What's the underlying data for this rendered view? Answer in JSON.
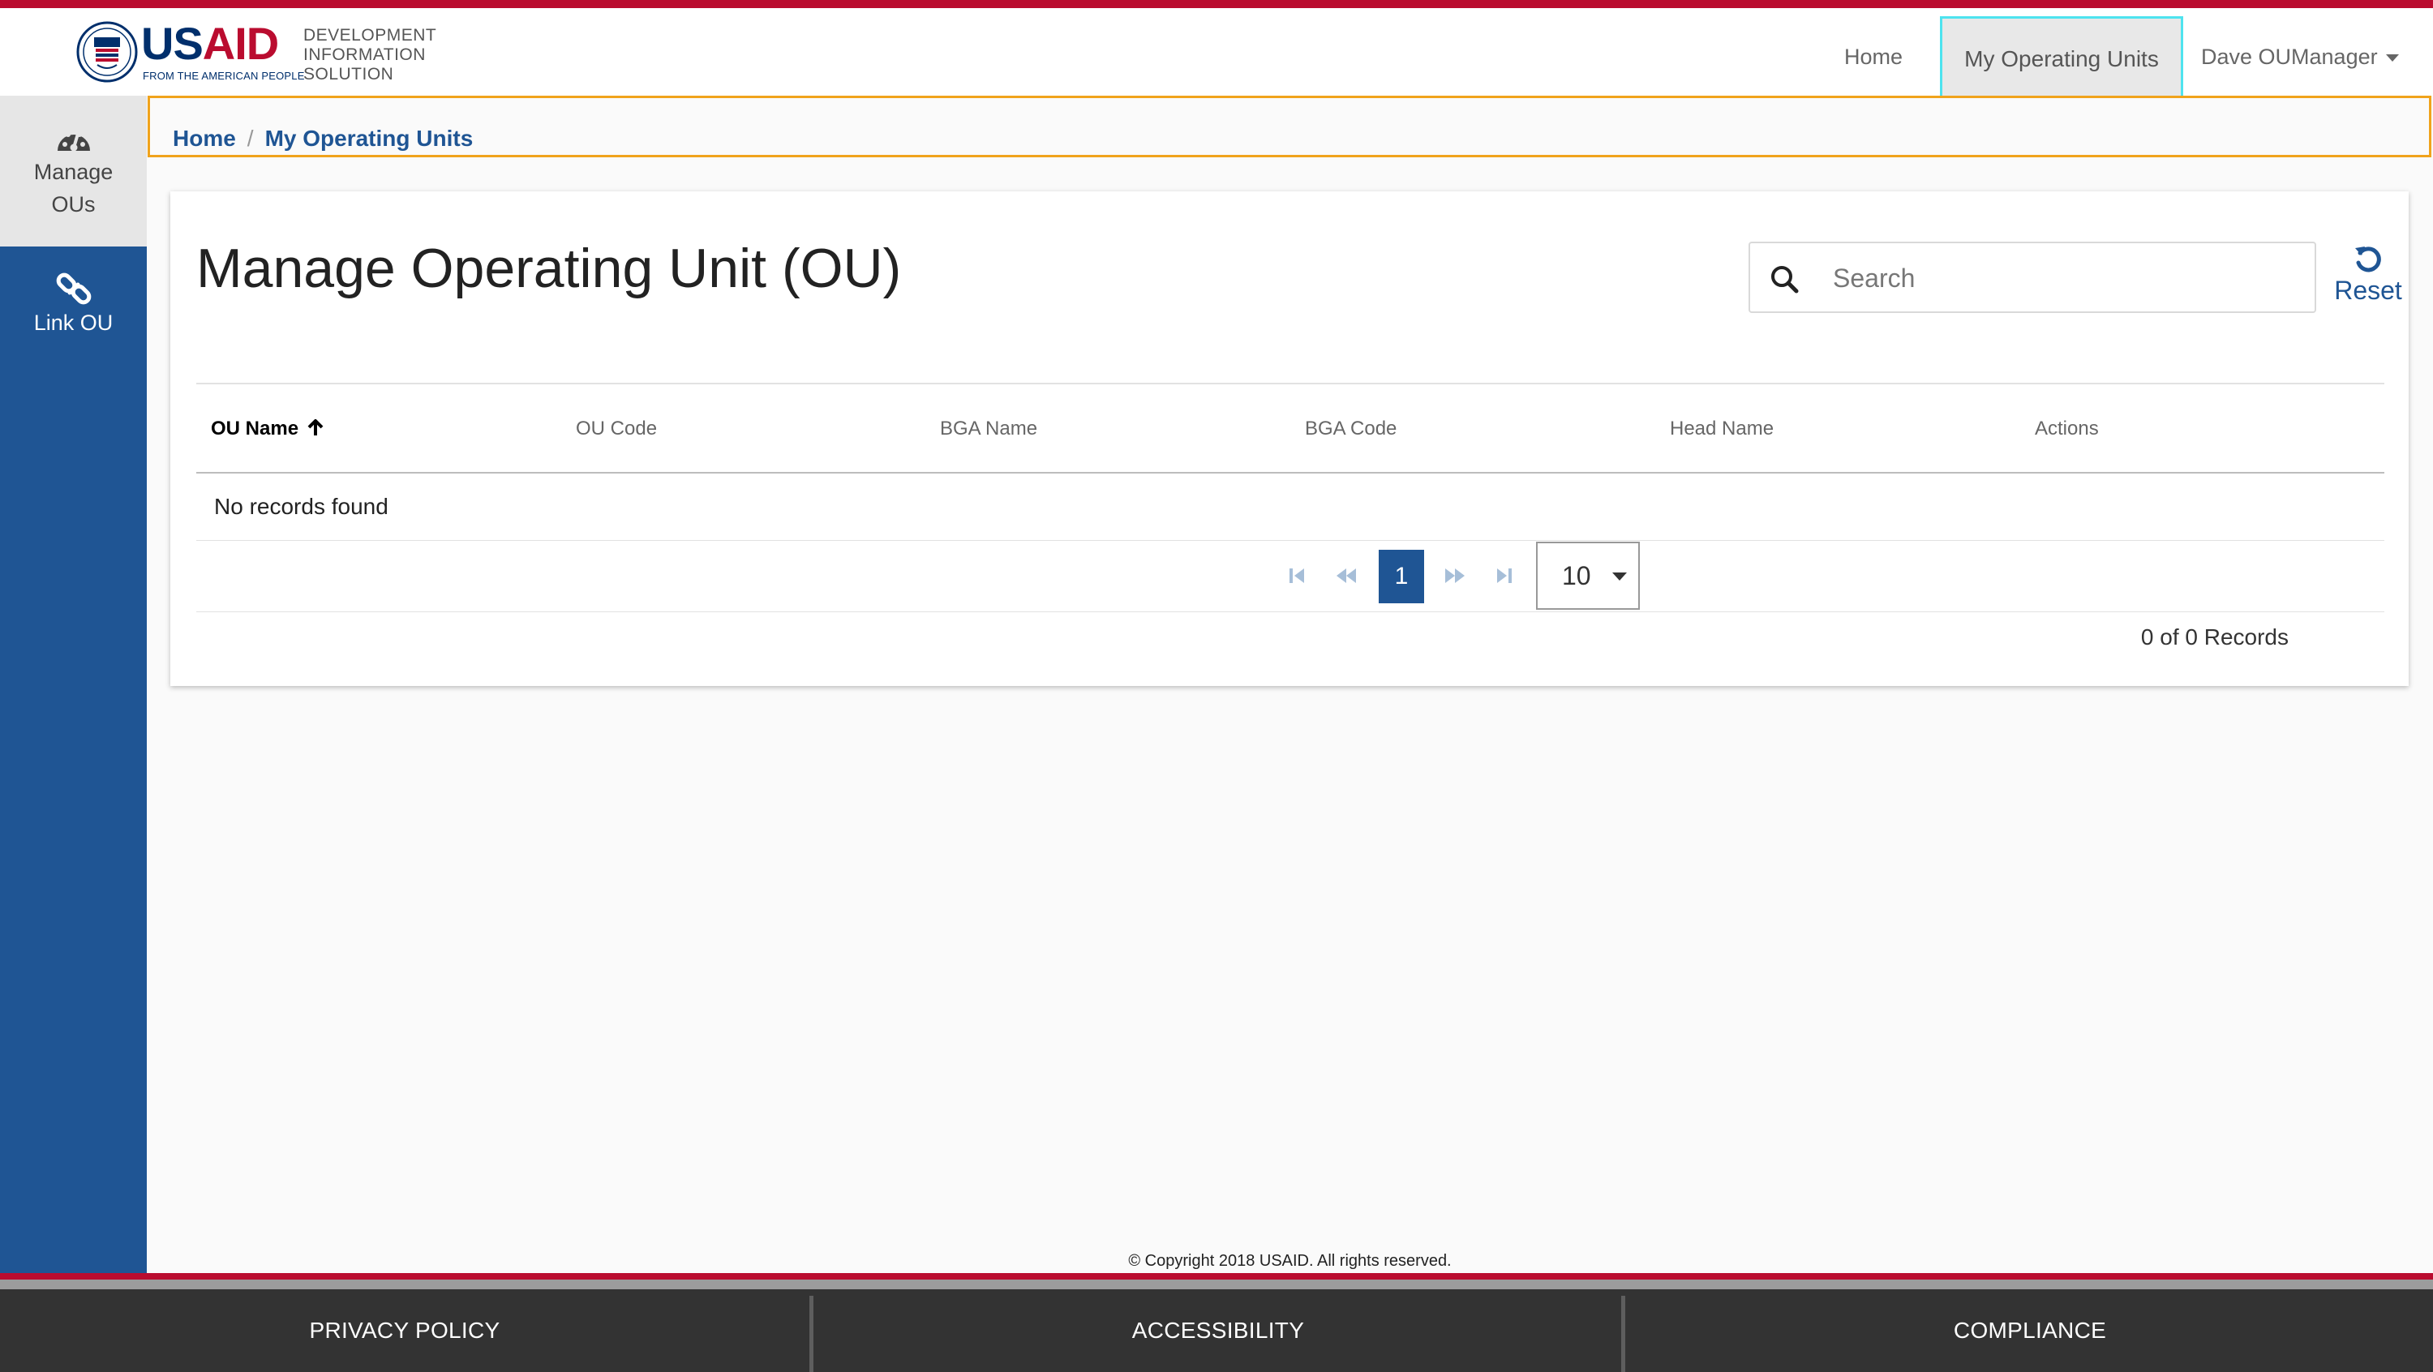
{
  "header": {
    "logo_text": "USAID",
    "logo_tagline": "FROM THE AMERICAN PEOPLE",
    "app_name_lines": [
      "DEVELOPMENT",
      "INFORMATION",
      "SOLUTION"
    ],
    "nav": {
      "home": "Home",
      "active": "My Operating Units",
      "user": "Dave OUManager"
    }
  },
  "sidebar": {
    "items": [
      {
        "label_line1": "Manage",
        "label_line2": "OUs",
        "icon": "dashboard-icon",
        "active": true
      },
      {
        "label": "Link OU",
        "icon": "link-icon",
        "active": false
      }
    ]
  },
  "breadcrumb": {
    "items": [
      "Home",
      "My Operating Units"
    ],
    "separator": "/"
  },
  "main": {
    "title": "Manage Operating Unit (OU)",
    "search": {
      "placeholder": "Search",
      "value": ""
    },
    "reset_label": "Reset",
    "table": {
      "columns": [
        "OU Name",
        "OU Code",
        "BGA Name",
        "BGA Code",
        "Head Name",
        "Actions"
      ],
      "sorted_column": "OU Name",
      "sort_direction": "ascending",
      "empty_message": "No records found",
      "rows": []
    },
    "pagination": {
      "current_page": "1",
      "page_size": "10",
      "records_summary": "0 of 0 Records"
    }
  },
  "footer": {
    "copyright": "© Copyright 2018 USAID. All rights reserved.",
    "links": [
      "PRIVACY POLICY",
      "ACCESSIBILITY",
      "COMPLIANCE"
    ]
  },
  "colors": {
    "brand_blue": "#1f5594",
    "brand_red": "#ba0c2f",
    "focus_outline": "#4ee3ef",
    "breadcrumb_border": "#f0a31c",
    "footer_bg": "#333333"
  }
}
